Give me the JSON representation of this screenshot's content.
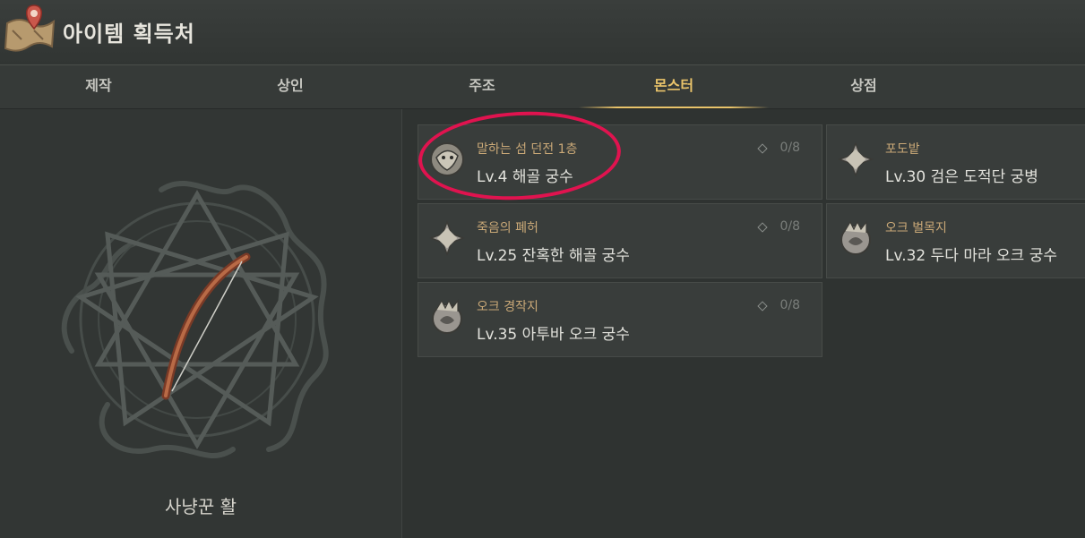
{
  "header": {
    "title": "아이템 획득처",
    "icon": "map-pin-scroll-icon"
  },
  "tabs": [
    {
      "label": "제작",
      "active": false
    },
    {
      "label": "상인",
      "active": false
    },
    {
      "label": "주조",
      "active": false
    },
    {
      "label": "몬스터",
      "active": true
    },
    {
      "label": "상점",
      "active": false
    }
  ],
  "item": {
    "name": "사냥꾼 활",
    "icon": "bow-icon"
  },
  "sources": [
    {
      "location": "말하는 섬 던전 1층",
      "monster": "Lv.4 해골 궁수",
      "count": "0/8",
      "icon": "beast-head-icon"
    },
    {
      "location": "포도밭",
      "monster": "Lv.30 검은 도적단 궁병",
      "count": "",
      "icon": "star-crest-icon"
    },
    {
      "location": "죽음의 폐허",
      "monster": "Lv.25 잔혹한 해골 궁수",
      "count": "0/8",
      "icon": "star-crest-icon"
    },
    {
      "location": "오크 벌목지",
      "monster": "Lv.32 두다 마라 오크 궁수",
      "count": "",
      "icon": "orc-crest-icon"
    },
    {
      "location": "오크 경작지",
      "monster": "Lv.35 아투바 오크 궁수",
      "count": "0/8",
      "icon": "orc-crest-icon"
    }
  ],
  "colors": {
    "accent": "#e9c36a",
    "highlight_circle": "#e0134f",
    "location_text": "#c9a877"
  }
}
